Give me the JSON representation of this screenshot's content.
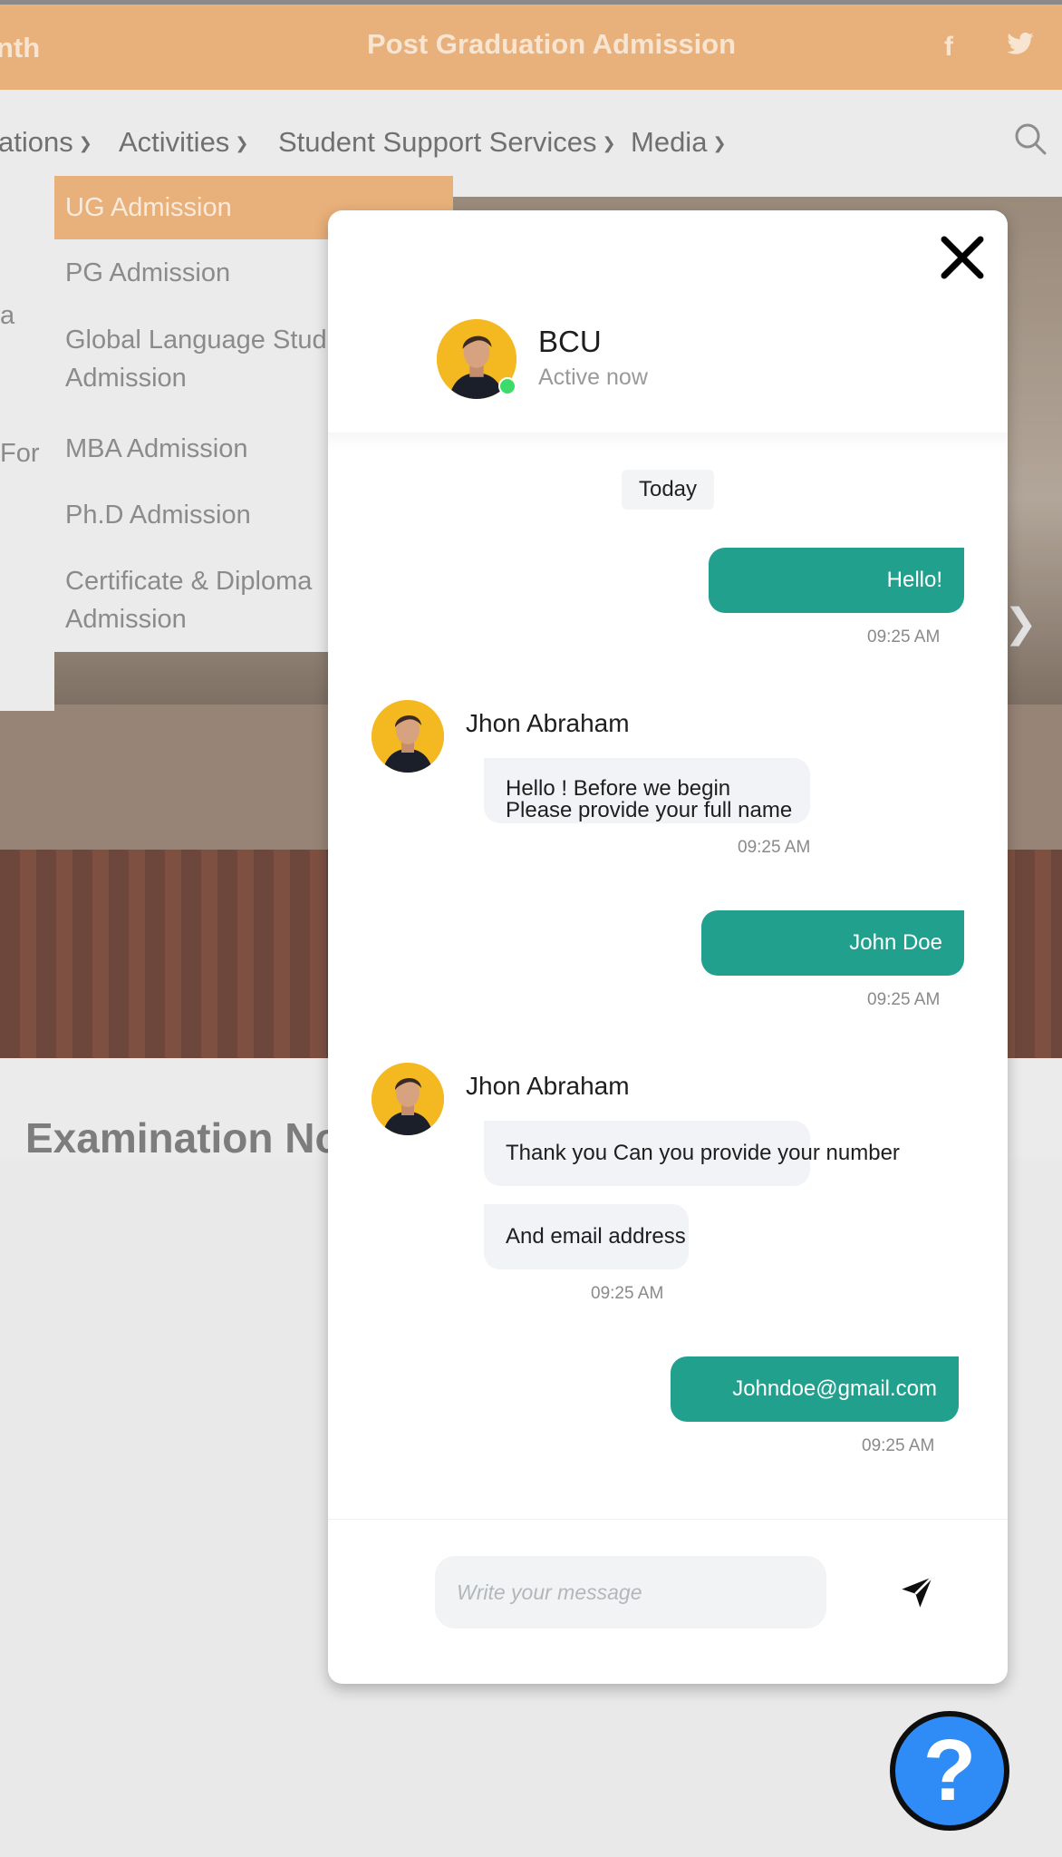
{
  "site": {
    "topbar": {
      "left_fragment": "nth",
      "title": "Post Graduation Admission",
      "social_icons": [
        "facebook-icon",
        "twitter-icon"
      ]
    },
    "nav": {
      "items": [
        "ations",
        "Activities",
        "Student Support Services",
        "Media"
      ],
      "search_icon": "search-icon"
    },
    "dropdown": {
      "items": [
        "UG Admission",
        "PG Admission",
        "Global Language Stud",
        "Admission",
        "MBA Admission",
        "Ph.D Admission",
        "Certificate & Diploma",
        "Admission"
      ],
      "left_fragments": [
        "a",
        "For"
      ]
    },
    "section_title": "Examination No",
    "colors": {
      "topbar": "#e8b07a",
      "accent": "#21a08e",
      "help": "#2f8bf5"
    }
  },
  "chat": {
    "header": {
      "name": "BCU",
      "status": "Active now"
    },
    "date_label": "Today",
    "messages": [
      {
        "from": "user",
        "text": "Hello!",
        "time": "09:25 AM"
      },
      {
        "from": "agent",
        "sender": "Jhon Abraham",
        "lines": [
          "Hello !  Before we begin",
          "Please provide your full name"
        ],
        "time": "09:25 AM"
      },
      {
        "from": "user",
        "text": "John Doe",
        "time": "09:25 AM"
      },
      {
        "from": "agent",
        "sender": "Jhon Abraham",
        "texts": [
          "Thank you Can you provide your number",
          "And email address"
        ],
        "time": "09:25 AM"
      },
      {
        "from": "user",
        "text": "Johndoe@gmail.com",
        "time": "09:25 AM"
      }
    ],
    "input": {
      "placeholder": "Write your message",
      "value": ""
    },
    "help_symbol": "?"
  }
}
